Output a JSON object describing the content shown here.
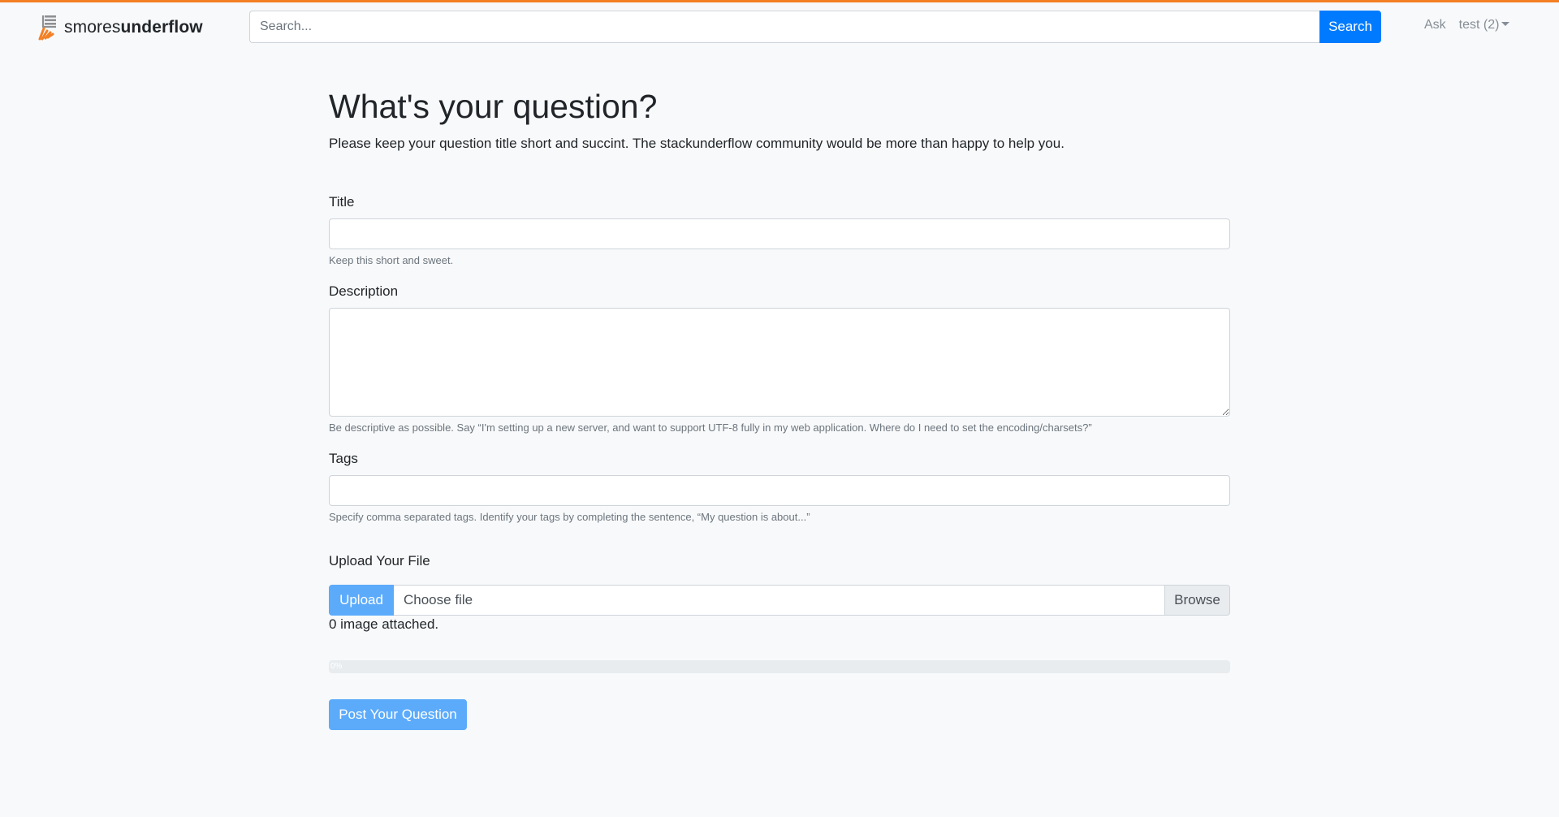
{
  "brand": {
    "name_light": "smores",
    "name_bold": "underflow"
  },
  "search": {
    "placeholder": "Search...",
    "value": "",
    "button_label": "Search"
  },
  "nav": {
    "ask_label": "Ask",
    "user_label": "test (2)"
  },
  "page": {
    "title": "What's your question?",
    "lead": "Please keep your question title short and succint. The stackunderflow community would be more than happy to help you."
  },
  "form": {
    "title": {
      "label": "Title",
      "value": "",
      "help": "Keep this short and sweet."
    },
    "description": {
      "label": "Description",
      "value": "",
      "help": "Be descriptive as possible. Say “I'm setting up a new server, and want to support UTF-8 fully in my web application. Where do I need to set the encoding/charsets?”"
    },
    "tags": {
      "label": "Tags",
      "value": "",
      "help": "Specify comma separated tags. Identify your tags by completing the sentence, “My question is about...”"
    },
    "upload": {
      "section_label": "Upload Your File",
      "upload_label": "Upload",
      "file_placeholder": "Choose file",
      "browse_label": "Browse",
      "attached_text": "0 image attached.",
      "progress": 0,
      "progress_text": "0%"
    },
    "submit_label": "Post Your Question"
  },
  "colors": {
    "accent": "#f48024",
    "primary": "#007bff",
    "primary_light": "#5cabfb",
    "background": "#f8f9fa"
  }
}
